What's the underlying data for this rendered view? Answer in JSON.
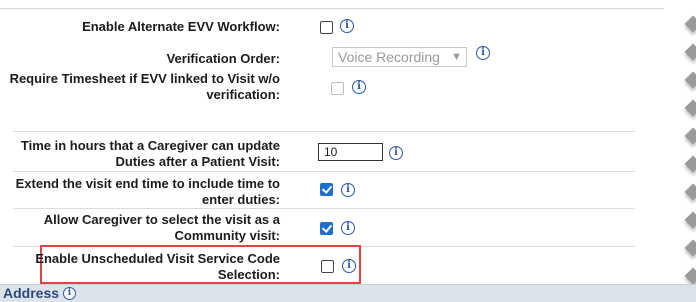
{
  "settings": {
    "enable_alt_evv": {
      "label": "Enable Alternate EVV Workflow:",
      "checked": false
    },
    "verification_order": {
      "label": "Verification Order:",
      "value": "Voice Recording"
    },
    "require_timesheet": {
      "label_line1": "Require Timesheet if EVV linked to Visit w/o",
      "label_line2": "verification:",
      "checked": false,
      "disabled": true
    },
    "update_duties_hours": {
      "label_line1": "Time in hours that a Caregiver can update",
      "label_line2": "Duties after a Patient Visit:",
      "value": "10"
    },
    "extend_visit_end": {
      "label_line1": "Extend the visit end time to include time to",
      "label_line2": "enter duties:",
      "checked": true
    },
    "community_visit": {
      "label_line1": "Allow Caregiver to select the visit as a",
      "label_line2": "Community visit:",
      "checked": true
    },
    "unscheduled_service_code": {
      "label_line1": "Enable Unscheduled Visit Service Code",
      "label_line2": "Selection:",
      "checked": false
    }
  },
  "info_glyph": "i",
  "section_footer": {
    "label": "Address"
  },
  "icons": {
    "info": "info-icon",
    "dropdown": "chevron-down-icon"
  },
  "colors": {
    "checkbox_checked": "#1a6fd0",
    "highlight_border": "#e04545",
    "footer_bg": "#dde3ea",
    "info_icon": "#2b57a8"
  }
}
